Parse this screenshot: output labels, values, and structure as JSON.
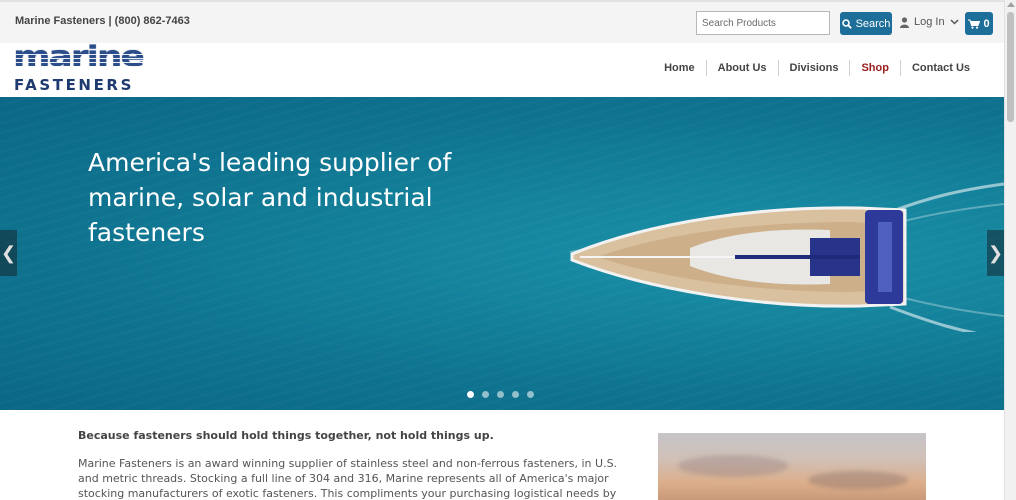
{
  "topbar": {
    "company_phone": "Marine Fasteners | (800) 862-7463",
    "search_placeholder": "Search Products",
    "search_button": "Search",
    "login_label": "Log In",
    "cart_count": "0"
  },
  "logo": {
    "word1": "marine",
    "word2": "FASTENERS"
  },
  "nav": {
    "items": [
      "Home",
      "About Us",
      "Divisions",
      "Shop",
      "Contact Us"
    ],
    "active": "Shop"
  },
  "hero": {
    "title": "America's leading supplier of marine, solar and industrial fasteners",
    "slide_count": 5,
    "active_slide": 1
  },
  "content": {
    "tagline": "Because fasteners should hold things together, not hold things up.",
    "body": "Marine Fasteners is an award winning supplier of stainless steel and non-ferrous fasteners, in U.S. and metric threads. Stocking a full line of 304 and 316, Marine represents all of America's major stocking manufacturers of exotic fasteners. This compliments your purchasing logistical needs by offering you the most competitive price."
  },
  "colors": {
    "accent": "#1d6e99",
    "nav_active": "#9a1b1b",
    "logo_blue": "#2b4d8a"
  },
  "icons": {
    "search": "search-icon",
    "user": "user-icon",
    "chevron": "chevron-down-icon",
    "cart": "cart-icon",
    "prev": "chevron-left-icon",
    "next": "chevron-right-icon"
  }
}
